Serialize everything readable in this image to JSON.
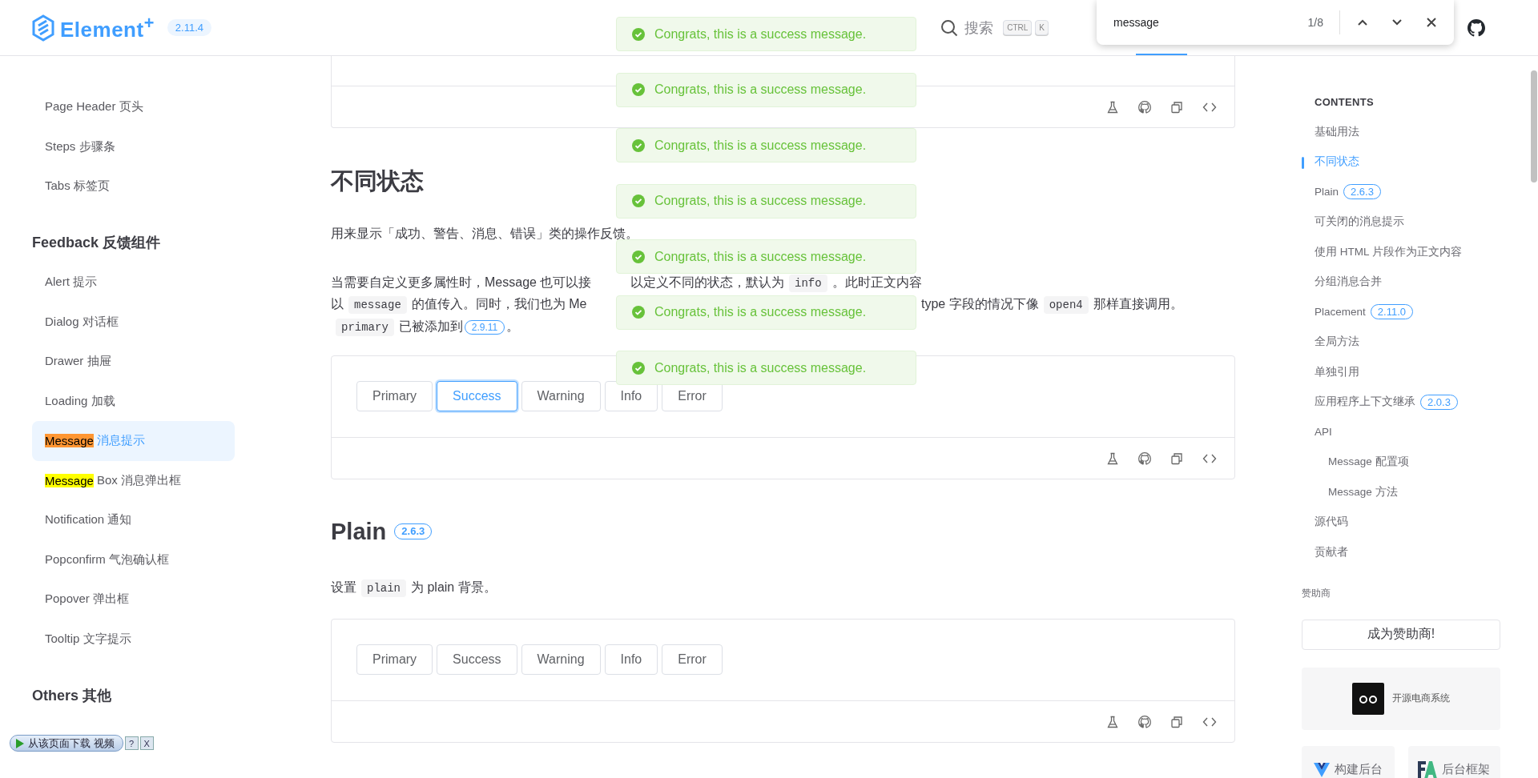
{
  "header": {
    "logo": "Element$^{+}$",
    "version": "2.11.4",
    "search": {
      "label": "搜索",
      "keys": [
        "CTRL",
        "K"
      ]
    }
  },
  "find_bar": {
    "query": "message",
    "count": "1/8"
  },
  "toasts": [
    {
      "kind": "success",
      "text": "Congrats, this is a success message."
    },
    {
      "kind": "success",
      "text": "Congrats, this is a success message."
    },
    {
      "kind": "success",
      "text": "Congrats, this is a success message."
    },
    {
      "kind": "success",
      "text": "Congrats, this is a success message."
    },
    {
      "kind": "success",
      "text": "Congrats, this is a success message."
    },
    {
      "kind": "success",
      "text": "Congrats, this is a success message."
    },
    {
      "kind": "success",
      "text": "Congrats, this is a success message."
    }
  ],
  "sidebar": {
    "items": [
      {
        "kind": "item",
        "text": "Page Header 页头",
        "selected": false
      },
      {
        "kind": "item",
        "text": "Steps 步骤条",
        "selected": false
      },
      {
        "kind": "item",
        "text": "Tabs 标签页",
        "selected": false
      },
      {
        "kind": "heading",
        "text": "Feedback 反馈组件"
      },
      {
        "kind": "item",
        "text": "Alert 提示",
        "selected": false
      },
      {
        "kind": "item",
        "text": "Dialog 对话框",
        "selected": false
      },
      {
        "kind": "item",
        "text": "Drawer 抽屉",
        "selected": false
      },
      {
        "kind": "item",
        "text": "Loading 加载",
        "selected": false
      },
      {
        "kind": "item",
        "highlight": "Message",
        "current": true,
        "text": "消息提示",
        "selected": true
      },
      {
        "kind": "item",
        "highlight": "Message",
        "current": false,
        "text": "Box 消息弹出框",
        "selected": false
      },
      {
        "kind": "item",
        "text": "Notification 通知",
        "selected": false
      },
      {
        "kind": "item",
        "text": "Popconfirm 气泡确认框",
        "selected": false
      },
      {
        "kind": "item",
        "text": "Popover 弹出框",
        "selected": false
      },
      {
        "kind": "item",
        "text": "Tooltip 文字提示",
        "selected": false
      },
      {
        "kind": "heading",
        "text": "Others 其他"
      }
    ]
  },
  "download_bar": {
    "label": "从该页面下载 视频",
    "help": "?",
    "close": "X"
  },
  "main": {
    "sections": [
      {
        "title": "不同状态",
        "paragraphs": [
          {
            "kind": "plain",
            "segments": [
              {
                "kind": "text",
                "text": "用来显示「成功、警告、消息、错误」类的操作反馈。"
              }
            ]
          },
          {
            "kind": "lines",
            "lines": [
              {
                "left": [
                  {
                    "kind": "text",
                    "text": "当需要自定义更多属性时，Message 也可以接"
                  }
                ],
                "right": [
                  {
                    "kind": "text",
                    "text": "以定义不同的状态，默认为"
                  },
                  {
                    "kind": "code",
                    "text": "info"
                  },
                  {
                    "kind": "text",
                    "text": "。此时正文内容"
                  }
                ]
              },
              {
                "left": [
                  {
                    "kind": "text",
                    "text": "以"
                  },
                  {
                    "kind": "code",
                    "text": "message"
                  },
                  {
                    "kind": "text",
                    "text": "的值传入。同时，我们也为 Me"
                  }
                ],
                "right": [
                  {
                    "kind": "text",
                    "text": "type 字段的情况下像"
                  },
                  {
                    "kind": "code",
                    "text": "open4"
                  },
                  {
                    "kind": "text",
                    "text": "那样直接调用。"
                  }
                ]
              },
              {
                "left": [
                  {
                    "kind": "code",
                    "text": "primary"
                  },
                  {
                    "kind": "text",
                    "text": "已被添加到"
                  },
                  {
                    "kind": "badge",
                    "text": "2.9.11"
                  },
                  {
                    "kind": "text",
                    "text": "。"
                  }
                ]
              }
            ]
          }
        ],
        "demo": {
          "buttons": [
            {
              "text": "Primary",
              "focused": false
            },
            {
              "text": "Success",
              "focused": true
            },
            {
              "text": "Warning",
              "focused": false
            },
            {
              "text": "Info",
              "focused": false
            },
            {
              "text": "Error",
              "focused": false
            }
          ]
        }
      },
      {
        "title": "Plain",
        "badge": "2.6.3",
        "paragraphs": [
          {
            "kind": "plain",
            "segments": [
              {
                "kind": "text",
                "text": "设置"
              },
              {
                "kind": "code",
                "text": "plain"
              },
              {
                "kind": "text",
                "text": "为 plain 背景。"
              }
            ]
          }
        ],
        "demo": {
          "buttons": [
            {
              "text": "Primary",
              "focused": false
            },
            {
              "text": "Success",
              "focused": false
            },
            {
              "text": "Warning",
              "focused": false
            },
            {
              "text": "Info",
              "focused": false
            },
            {
              "text": "Error",
              "focused": false
            }
          ]
        }
      }
    ]
  },
  "toc": {
    "title": "CONTENTS",
    "items": [
      {
        "text": "基础用法",
        "selected": false
      },
      {
        "text": "不同状态",
        "selected": true
      },
      {
        "text": "Plain",
        "badge": "2.6.3",
        "selected": false
      },
      {
        "text": "可关闭的消息提示",
        "selected": false
      },
      {
        "text": "使用 HTML 片段作为正文内容",
        "selected": false
      },
      {
        "text": "分组消息合并",
        "selected": false
      },
      {
        "text": "Placement",
        "badge": "2.11.0",
        "selected": false
      },
      {
        "text": "全局方法",
        "selected": false
      },
      {
        "text": "单独引用",
        "selected": false
      },
      {
        "text": "应用程序上下文继承",
        "badge": "2.0.3",
        "selected": false
      },
      {
        "text": "API",
        "selected": false,
        "children": [
          {
            "text": "Message 配置项",
            "selected": false
          },
          {
            "text": "Message 方法",
            "selected": false
          }
        ]
      },
      {
        "text": "源代码",
        "selected": false
      },
      {
        "text": "贡献者",
        "selected": false
      }
    ]
  },
  "sponsors": {
    "label": "赞助商",
    "become": "成为赞助商!",
    "featured": {
      "text": "开源电商系统"
    },
    "tiles": [
      {
        "kind": "v",
        "text": "构建后台"
      },
      {
        "kind": "fa",
        "text": "后台框架"
      }
    ]
  }
}
